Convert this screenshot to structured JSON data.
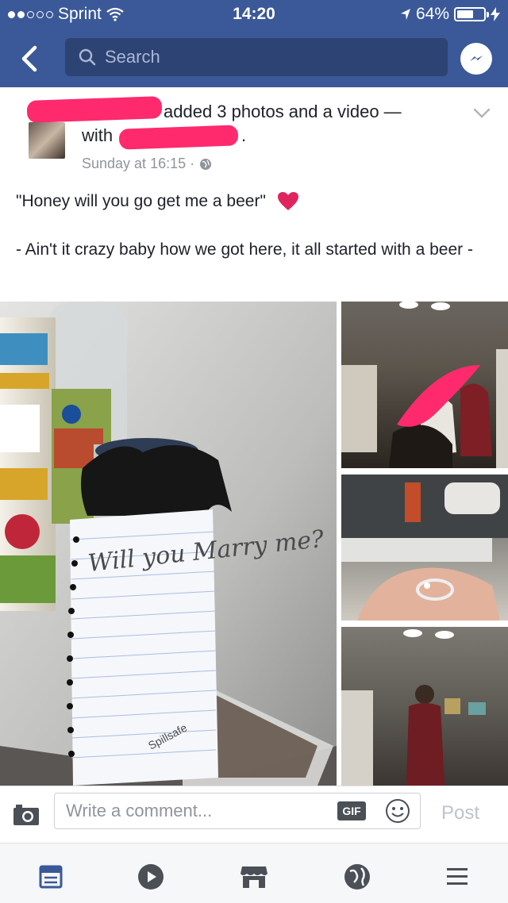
{
  "status_bar": {
    "carrier": "Sprint",
    "time": "14:20",
    "battery": "64%",
    "battery_level": 0.64
  },
  "nav": {
    "search_placeholder": "Search"
  },
  "post": {
    "action_text": "added 3 photos and a video —",
    "with_label": "with",
    "with_suffix": ".",
    "timestamp": "Sunday at 16:15 ·",
    "text_line1": "\"Honey will you go get me a beer\"",
    "text_line2": "- Ain't it crazy baby how we got here, it all started with a beer -"
  },
  "photos": {
    "note_text": "Will you Marry me?",
    "watermark": "Spillsafe"
  },
  "comment_bar": {
    "placeholder": "Write a comment...",
    "gif_label": "GIF",
    "post_label": "Post"
  },
  "tabs": [
    "news-feed",
    "watch",
    "marketplace",
    "notifications",
    "menu"
  ],
  "colors": {
    "header_bg": "#3b5998",
    "search_bg": "#2d4373",
    "redaction": "#ff2a6d",
    "heart": "#e0245e"
  }
}
